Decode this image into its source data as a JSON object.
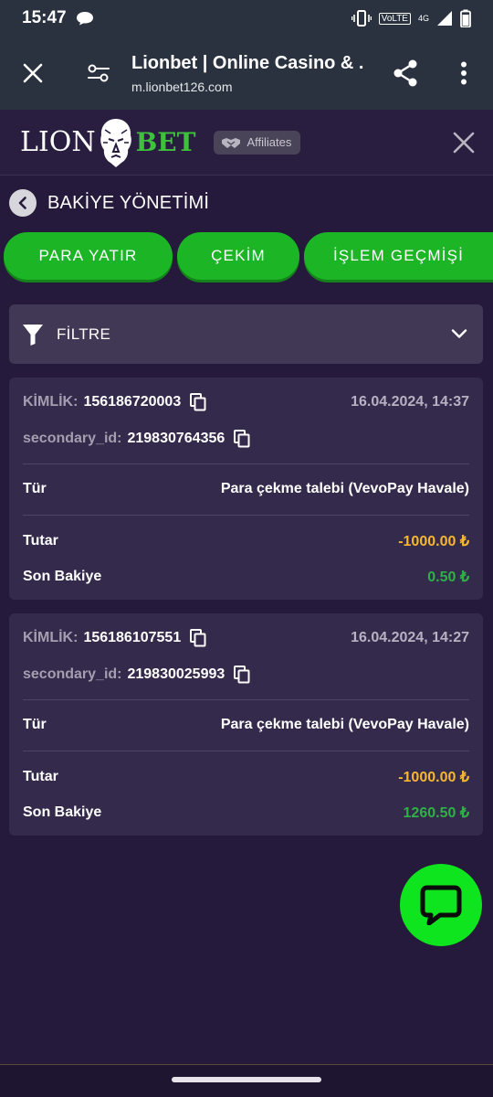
{
  "status_bar": {
    "time": "15:47",
    "volte": "VoLTE",
    "network": "4G"
  },
  "browser": {
    "title": "Lionbet | Online Casino & ...",
    "url": "m.lionbet126.com"
  },
  "site": {
    "logo_left": "LION",
    "logo_right": "BET",
    "affiliates_label": "Affiliates"
  },
  "page": {
    "title": "BAKİYE YÖNETİMİ"
  },
  "tabs": [
    {
      "label": "PARA YATIR"
    },
    {
      "label": "ÇEKİM"
    },
    {
      "label": "İŞLEM GEÇMİŞİ"
    }
  ],
  "filter": {
    "label": "FİLTRE"
  },
  "labels": {
    "id": "KİMLİK:",
    "secondary_id": "secondary_id:",
    "type": "Tür",
    "amount": "Tutar",
    "balance": "Son Bakiye"
  },
  "transactions": [
    {
      "id": "156186720003",
      "date": "16.04.2024, 14:37",
      "secondary_id": "219830764356",
      "type": "Para çekme talebi (VevoPay Havale)",
      "amount": "-1000.00 ₺",
      "balance": "0.50 ₺"
    },
    {
      "id": "156186107551",
      "date": "16.04.2024, 14:27",
      "secondary_id": "219830025993",
      "type": "Para çekme talebi (VevoPay Havale)",
      "amount": "-1000.00 ₺",
      "balance": "1260.50 ₺"
    }
  ],
  "colors": {
    "background": "#251a3b",
    "tab_green": "#1bb526",
    "amount_orange": "#f5b731",
    "balance_green": "#2fb147",
    "chat_green": "#0ee51e"
  }
}
